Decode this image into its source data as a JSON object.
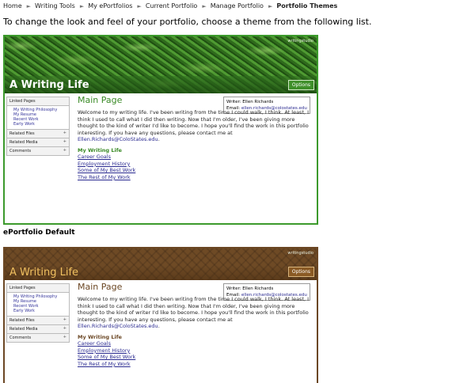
{
  "breadcrumb": {
    "items": [
      "Home",
      "Writing Tools",
      "My ePortfolios",
      "Current Portfolio",
      "Manage Portfolio"
    ],
    "current": "Portfolio Themes"
  },
  "intro": "To change the look and feel of your portfolio, choose a theme from the following list.",
  "themes": [
    {
      "label": "ePortfolio Default",
      "site_title": "A Writing Life",
      "logo_text": "writingstudio",
      "options_label": "Options",
      "sidebar": {
        "linked_pages": "Linked Pages",
        "links": [
          "My Writing Philosophy",
          "My Resume",
          "Recent Work",
          "Early Work"
        ],
        "sections": [
          "Related Files",
          "Related Media",
          "Comments"
        ]
      },
      "main_title": "Main Page",
      "writer": "Writer: Ellen Richards",
      "email_label": "Email:",
      "email": "ellen.richards@colostates.edu",
      "paragraph": "Welcome to my writing life. I've been writing from the time I could walk, I think. At least, I think I used to call what I did then writing. Now that I'm older, I've been giving more thought to the kind of writer I'd like to become. I hope you'll find the work in this portfolio interesting. If you have any questions, please contact me at",
      "contact": "Ellen.Richards@ColoStates.edu",
      "list_title": "My Writing Life",
      "list_links": [
        "Career Goals",
        "Employment History",
        "Some of My Best Work",
        "The Rest of My Work"
      ],
      "accent": "#3c9a2c"
    },
    {
      "site_title": "A Writing Life",
      "logo_text": "writingstudio",
      "options_label": "Options",
      "sidebar": {
        "linked_pages": "Linked Pages",
        "links": [
          "My Writing Philosophy",
          "My Resume",
          "Recent Work",
          "Early Work"
        ],
        "sections": [
          "Related Files",
          "Related Media",
          "Comments"
        ]
      },
      "main_title": "Main Page",
      "writer": "Writer: Ellen Richards",
      "email_label": "Email:",
      "email": "ellen.richards@colostates.edu",
      "paragraph": "Welcome to my writing life. I've been writing from the time I could walk, I think. At least, I think I used to call what I did then writing. Now that I'm older, I've been giving more thought to the kind of writer I'd like to become. I hope you'll find the work in this portfolio interesting. If you have any questions, please contact me at",
      "contact": "Ellen.Richards@ColoStates.edu",
      "list_title": "My Writing Life",
      "list_links": [
        "Career Goals",
        "Employment History",
        "Some of My Best Work",
        "The Rest of My Work"
      ],
      "accent": "#6b4724"
    }
  ]
}
